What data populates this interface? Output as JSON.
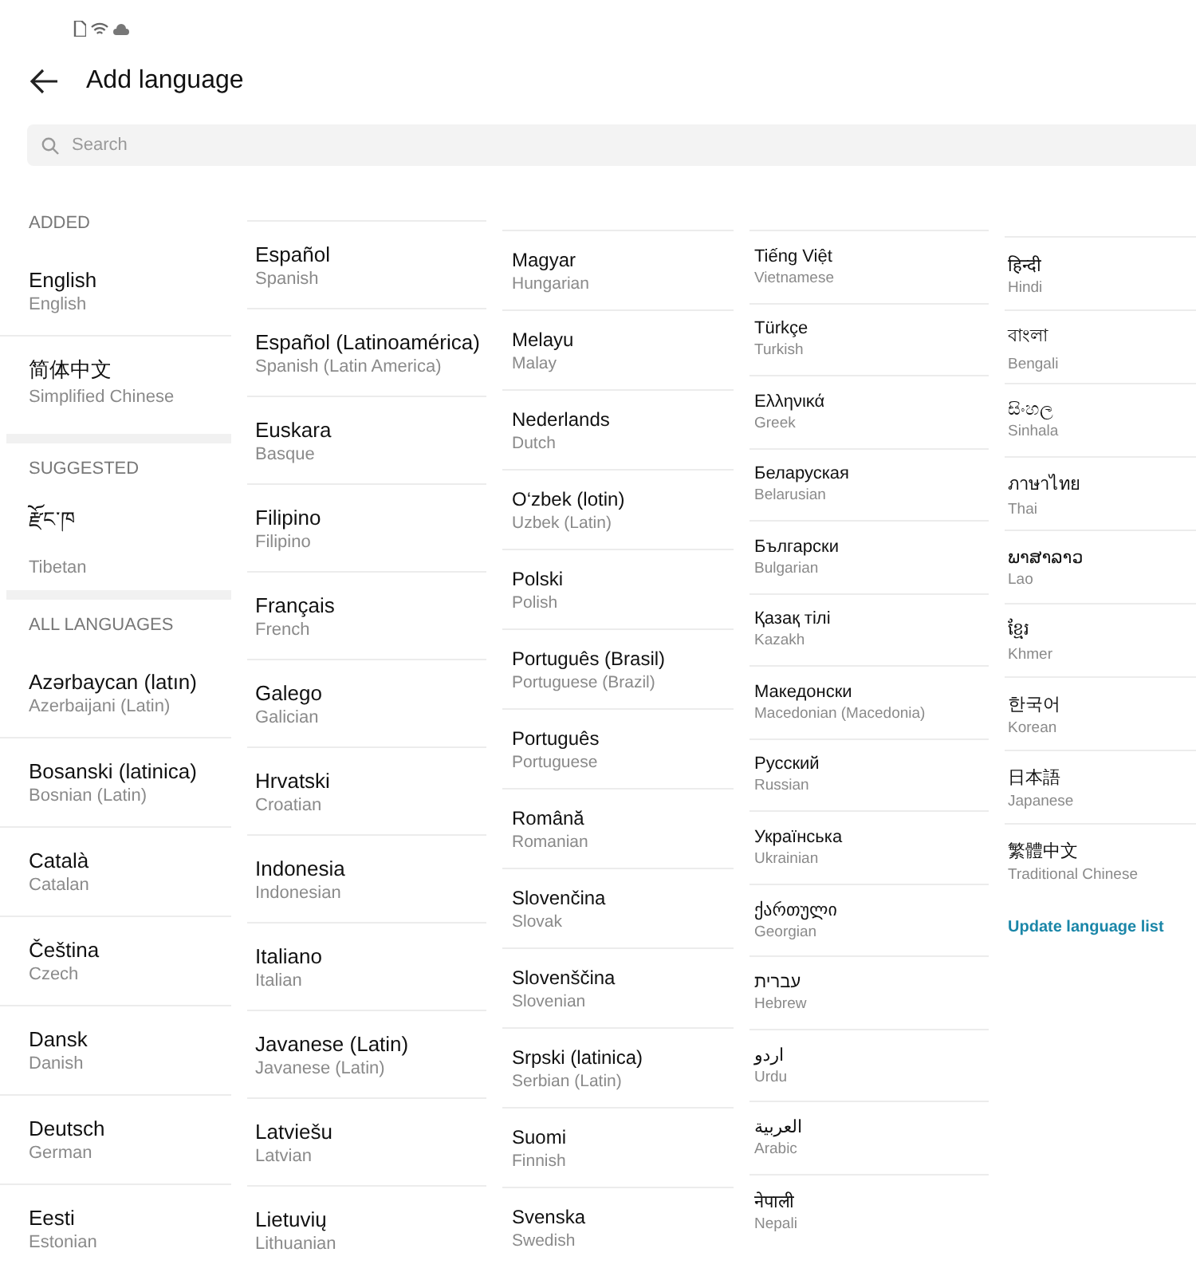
{
  "header": {
    "title": "Add language"
  },
  "search": {
    "placeholder": "Search"
  },
  "columns": [
    {
      "sections": [
        {
          "heading": "ADDED",
          "items": [
            {
              "name": "English",
              "english": "English"
            },
            {
              "name": "简体中文",
              "english": "Simplified Chinese"
            }
          ]
        },
        {
          "heading": "SUGGESTED",
          "items": [
            {
              "name": "རྫོང་ཁ",
              "english": "Tibetan"
            }
          ]
        },
        {
          "heading": "ALL LANGUAGES",
          "items": [
            {
              "name": "Azərbaycan (latın)",
              "english": "Azerbaijani (Latin)"
            },
            {
              "name": "Bosanski (latinica)",
              "english": "Bosnian (Latin)"
            },
            {
              "name": "Català",
              "english": "Catalan"
            },
            {
              "name": "Čeština",
              "english": "Czech"
            },
            {
              "name": "Dansk",
              "english": "Danish"
            },
            {
              "name": "Deutsch",
              "english": "German"
            },
            {
              "name": "Eesti",
              "english": "Estonian"
            }
          ]
        }
      ]
    },
    {
      "sections": [
        {
          "items": [
            {
              "name": "Español",
              "english": "Spanish"
            },
            {
              "name": "Español (Latinoamérica)",
              "english": "Spanish (Latin America)"
            },
            {
              "name": "Euskara",
              "english": "Basque"
            },
            {
              "name": "Filipino",
              "english": "Filipino"
            },
            {
              "name": "Français",
              "english": "French"
            },
            {
              "name": "Galego",
              "english": "Galician"
            },
            {
              "name": "Hrvatski",
              "english": "Croatian"
            },
            {
              "name": "Indonesia",
              "english": "Indonesian"
            },
            {
              "name": "Italiano",
              "english": "Italian"
            },
            {
              "name": "Javanese (Latin)",
              "english": "Javanese (Latin)"
            },
            {
              "name": "Latviešu",
              "english": "Latvian"
            },
            {
              "name": "Lietuvių",
              "english": "Lithuanian"
            }
          ]
        }
      ]
    },
    {
      "sections": [
        {
          "items": [
            {
              "name": "Magyar",
              "english": "Hungarian"
            },
            {
              "name": "Melayu",
              "english": "Malay"
            },
            {
              "name": "Nederlands",
              "english": "Dutch"
            },
            {
              "name": "O‘zbek (lotin)",
              "english": "Uzbek (Latin)"
            },
            {
              "name": "Polski",
              "english": "Polish"
            },
            {
              "name": "Português (Brasil)",
              "english": "Portuguese (Brazil)"
            },
            {
              "name": "Português",
              "english": "Portuguese"
            },
            {
              "name": "Română",
              "english": "Romanian"
            },
            {
              "name": "Slovenčina",
              "english": "Slovak"
            },
            {
              "name": "Slovenščina",
              "english": "Slovenian"
            },
            {
              "name": "Srpski (latinica)",
              "english": "Serbian (Latin)"
            },
            {
              "name": "Suomi",
              "english": "Finnish"
            },
            {
              "name": "Svenska",
              "english": "Swedish"
            }
          ]
        }
      ]
    },
    {
      "sections": [
        {
          "items": [
            {
              "name": "Tiếng Việt",
              "english": "Vietnamese"
            },
            {
              "name": "Türkçe",
              "english": "Turkish"
            },
            {
              "name": "Ελληνικά",
              "english": "Greek"
            },
            {
              "name": "Беларуская",
              "english": "Belarusian"
            },
            {
              "name": "Български",
              "english": "Bulgarian"
            },
            {
              "name": "Қазақ тілі",
              "english": "Kazakh"
            },
            {
              "name": "Македонски",
              "english": "Macedonian (Macedonia)"
            },
            {
              "name": "Русский",
              "english": "Russian"
            },
            {
              "name": "Українська",
              "english": "Ukrainian"
            },
            {
              "name": "ქართული",
              "english": "Georgian"
            },
            {
              "name": "עברית",
              "english": "Hebrew"
            },
            {
              "name": "اردو",
              "english": "Urdu"
            },
            {
              "name": "العربية",
              "english": "Arabic"
            },
            {
              "name": "नेपाली",
              "english": "Nepali"
            }
          ]
        }
      ]
    },
    {
      "sections": [
        {
          "items": [
            {
              "name": "हिन्दी",
              "english": "Hindi"
            },
            {
              "name": "বাংলা",
              "english": "Bengali"
            },
            {
              "name": "සිංහල",
              "english": "Sinhala"
            },
            {
              "name": "ภาษาไทย",
              "english": "Thai"
            },
            {
              "name": "ພາສາລາວ",
              "english": "Lao"
            },
            {
              "name": "ខ្មែរ",
              "english": "Khmer"
            },
            {
              "name": "한국어",
              "english": "Korean"
            },
            {
              "name": "日本語",
              "english": "Japanese"
            },
            {
              "name": "繁體中文",
              "english": "Traditional Chinese"
            }
          ]
        }
      ],
      "footer_link": "Update language list"
    }
  ]
}
